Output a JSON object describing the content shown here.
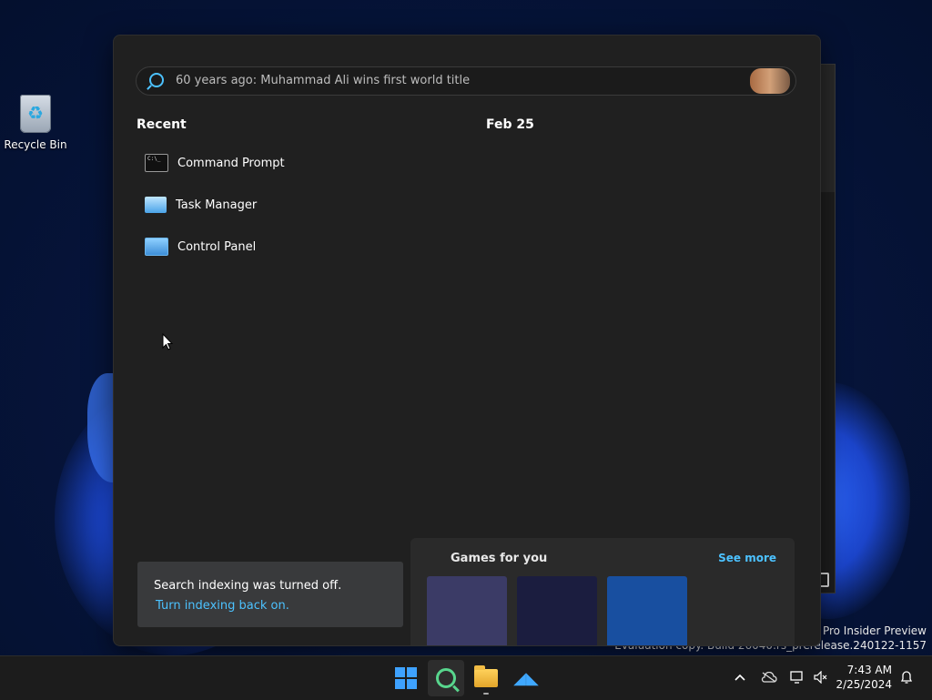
{
  "desktop": {
    "icons": [
      {
        "label": "Recycle Bin"
      }
    ],
    "watermark": {
      "line1": "s 11 Pro Insider Preview",
      "line2": "Evaluation copy. Build 26040.rs_prerelease.240122-1157"
    }
  },
  "search_panel": {
    "search": {
      "placeholder": "60 years ago: Muhammad Ali wins first world title"
    },
    "recent": {
      "title": "Recent",
      "items": [
        {
          "label": "Command Prompt",
          "icon": "command-prompt-icon"
        },
        {
          "label": "Task Manager",
          "icon": "task-manager-icon"
        },
        {
          "label": "Control Panel",
          "icon": "control-panel-icon"
        }
      ]
    },
    "date_header": "Feb 25",
    "indexing": {
      "message": "Search indexing was turned off.",
      "link": "Turn indexing back on."
    },
    "games": {
      "title": "Games for you",
      "see_more": "See more",
      "tile_colors": [
        "#3b3b66",
        "#1b1d3f",
        "#184fa0"
      ]
    }
  },
  "taskbar": {
    "apps": [
      "start",
      "search",
      "file-explorer",
      "dolphin"
    ],
    "clock": {
      "time": "7:43 AM",
      "date": "2/25/2024"
    }
  },
  "colors": {
    "accent": "#4cc2ff",
    "start": "#3ea2ff",
    "search": "#58d68d"
  }
}
